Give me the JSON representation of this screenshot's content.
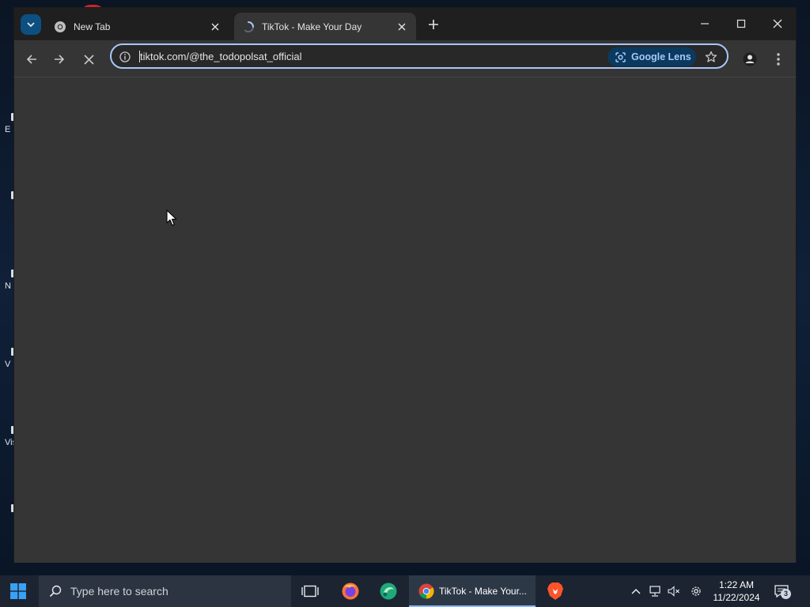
{
  "desktop": {
    "icon_labels": [
      "E",
      "N",
      "V",
      "Vis"
    ]
  },
  "browser": {
    "tabs": [
      {
        "title": "New Tab",
        "icon": "chrome-icon",
        "active": false
      },
      {
        "title": "TikTok - Make Your Day",
        "icon": "loading-spinner-icon",
        "active": true
      }
    ],
    "address": {
      "url": "tiktok.com/@the_todopolsat_official",
      "lens_label": "Google Lens"
    },
    "loading": true
  },
  "taskbar": {
    "search_placeholder": "Type here to search",
    "chrome_label": "TikTok - Make Your...",
    "clock_time": "1:22 AM",
    "clock_date": "11/22/2024",
    "notification_count": "3"
  },
  "colors": {
    "accent": "#a8c7fa",
    "tab_strip": "#1f1f1f",
    "page_bg": "#353535",
    "taskbar": "#1c2431"
  }
}
